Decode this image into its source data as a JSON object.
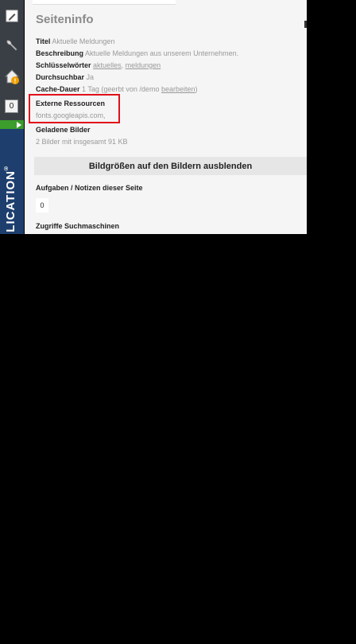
{
  "toolbar": {
    "counter_value": "0",
    "brand_vertical_text": "LICATION",
    "brand_mark": "®",
    "icons": [
      "pencil-icon",
      "wrench-icon",
      "home-warning-icon",
      "play-arrow-icon"
    ]
  },
  "panel": {
    "title": "Seiteninfo",
    "fields": {
      "titel_label": "Titel",
      "titel_value": "Aktuelle Meldungen",
      "beschreibung_label": "Beschreibung",
      "beschreibung_value": "Aktuelle Meldungen aus unserem Unternehmen.",
      "schluessel_label": "Schlüsselwörter",
      "schluessel_link1": "aktuelles",
      "schluessel_sep": ", ",
      "schluessel_link2": "meldungen",
      "durchsuchbar_label": "Durchsuchbar",
      "durchsuchbar_value": "Ja",
      "cache_label": "Cache-Dauer",
      "cache_value": "1 Tag (geerbt von /demo ",
      "cache_link": "bearbeiten",
      "cache_close": ")"
    },
    "externe_heading": "Externe Ressourcen",
    "externe_value": "fonts.googleapis.com,",
    "bilder_heading": "Geladene Bilder",
    "bilder_value": "2 Bilder mit insgesamt 91 KB",
    "hide_button_label": "Bildgrößen auf den Bildern ausblenden",
    "tasks_heading": "Aufgaben / Notizen dieser Seite",
    "tasks_count": "0",
    "zugriffe_heading": "Zugriffe Suchmaschinen"
  },
  "colors": {
    "highlight": "#e0101a",
    "toolbar": "#3a3f46",
    "green_bar": "#3c9c2c",
    "blue_strip": "#1e3f6e"
  }
}
